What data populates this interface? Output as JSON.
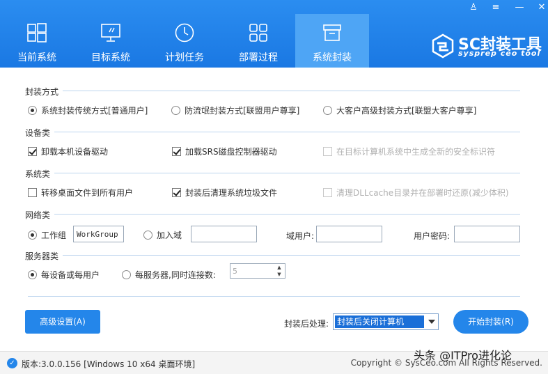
{
  "window_controls": [
    "♙",
    "≡",
    "—",
    "✕"
  ],
  "nav": {
    "tabs": [
      {
        "label": "当前系统",
        "icon": "windows-logo-icon",
        "active": false
      },
      {
        "label": "目标系统",
        "icon": "monitor-icon",
        "active": false
      },
      {
        "label": "计划任务",
        "icon": "clock-icon",
        "active": false
      },
      {
        "label": "部署过程",
        "icon": "grid-icon",
        "active": false
      },
      {
        "label": "系统封装",
        "icon": "package-box-icon",
        "active": true
      }
    ]
  },
  "logo": {
    "main": "SC封装工具",
    "sub": "sysprep ceo tool"
  },
  "sections": {
    "method": {
      "title": "封装方式",
      "options": [
        "系统封装传统方式[普通用户]",
        "防流氓封装方式[联盟用户尊享]",
        "大客户高级封装方式[联盟大客户尊享]"
      ],
      "selected": 0
    },
    "device": {
      "title": "设备类",
      "options": [
        {
          "label": "卸载本机设备驱动",
          "checked": true,
          "enabled": true
        },
        {
          "label": "加载SRS磁盘控制器驱动",
          "checked": true,
          "enabled": true
        },
        {
          "label": "在目标计算机系统中生成全新的安全标识符",
          "checked": false,
          "enabled": false
        }
      ]
    },
    "system": {
      "title": "系统类",
      "options": [
        {
          "label": "转移桌面文件到所有用户",
          "checked": false,
          "enabled": true
        },
        {
          "label": "封装后清理系统垃圾文件",
          "checked": true,
          "enabled": true
        },
        {
          "label": "清理DLLcache目录并在部署时还原(减少体积)",
          "checked": false,
          "enabled": false
        }
      ]
    },
    "network": {
      "title": "网络类",
      "workgroup_label": "工作组",
      "workgroup_value": "WorkGroup",
      "domain_label": "加入域",
      "domain_value": "",
      "domain_user_label": "域用户:",
      "domain_user_value": "",
      "password_label": "用户密码:",
      "password_value": ""
    },
    "server": {
      "title": "服务器类",
      "per_device_label": "每设备或每用户",
      "per_server_label": "每服务器,同时连接数:",
      "connections": "5"
    }
  },
  "actions": {
    "advanced_label": "高级设置(A)",
    "post_label": "封装后处理:",
    "post_value": "封装后关闭计算机",
    "start_label": "开始封装(R)"
  },
  "footer": {
    "version": "版本:3.0.0.156 [Windows 10 x64 桌面环境]",
    "copyright": "Copyright © SysCeo.com All Rights Reserved.",
    "watermark": "头条 @ITPro进化论"
  }
}
